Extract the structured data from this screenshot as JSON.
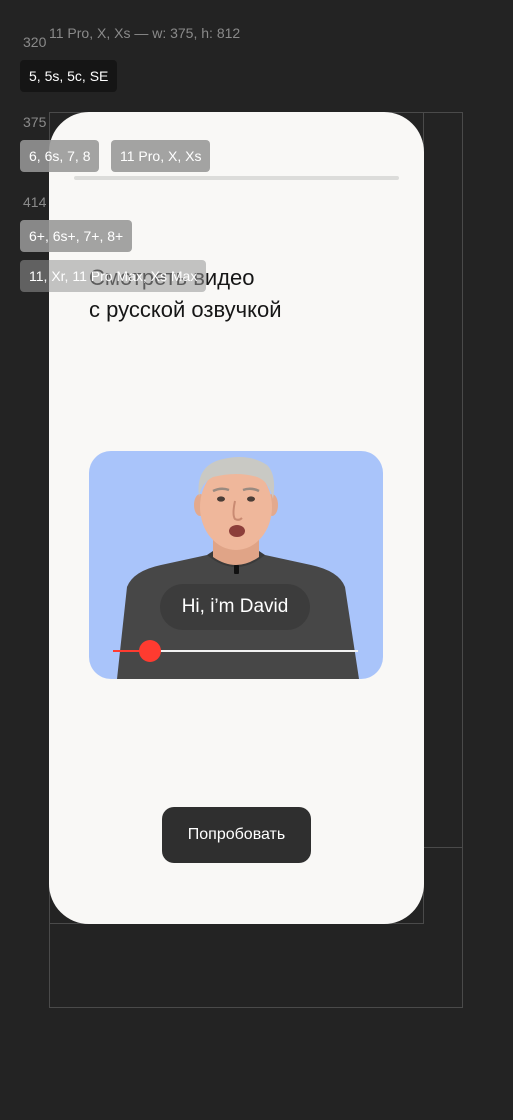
{
  "guides": {
    "width_320": "320",
    "width_375": "375",
    "width_414": "414",
    "frame_label": "11 Pro, X, Xs — w: 375, h: 812"
  },
  "device_chips": {
    "se": "5, 5s, 5c, SE",
    "iphone8": "6, 6s, 7, 8",
    "iphone_x": "11 Pro, X, Xs",
    "iphone_plus": "6+, 6s+, 7+, 8+",
    "iphone_max": "11, Xr, 11 Pro Max, Xs Max"
  },
  "screen": {
    "headline_line1": "Смотреть видео",
    "headline_line2": "с русской озвучкой",
    "video": {
      "caption": "Hi, i’m David",
      "playback_progress": 0.15
    },
    "cta_label": "Попробовать"
  },
  "colors": {
    "background": "#232323",
    "screen": "#f9f8f6",
    "video_bg": "#a9c4fa",
    "accent": "#ff3b30",
    "button": "#2f2f2f"
  }
}
